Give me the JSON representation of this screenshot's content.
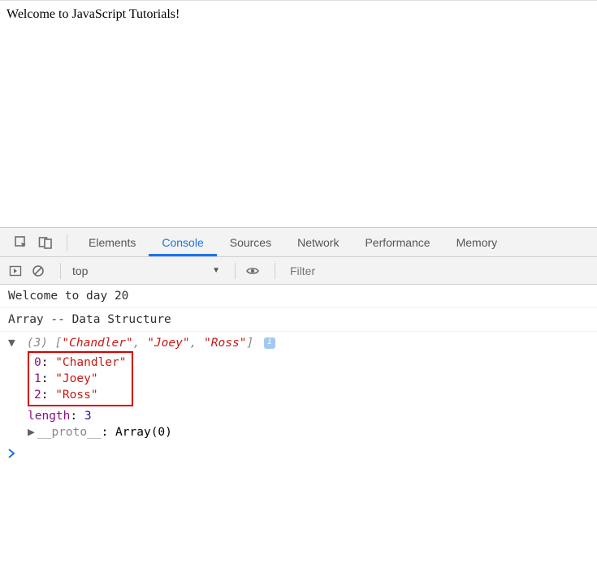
{
  "page": {
    "heading": "Welcome to JavaScript Tutorials!"
  },
  "devtools": {
    "tabs": [
      "Elements",
      "Console",
      "Sources",
      "Network",
      "Performance",
      "Memory"
    ],
    "active_tab": "Console",
    "context": "top",
    "filter_placeholder": "Filter",
    "console": {
      "lines": [
        "Welcome to day 20",
        "Array -- Data Structure"
      ],
      "array_summary": {
        "length_label": "(3)",
        "preview": "[\"Chandler\", \"Joey\", \"Ross\"]"
      },
      "array_items": [
        {
          "index": "0",
          "value": "\"Chandler\""
        },
        {
          "index": "1",
          "value": "\"Joey\""
        },
        {
          "index": "2",
          "value": "\"Ross\""
        }
      ],
      "length_key": "length",
      "length_val": "3",
      "proto_key": "__proto__",
      "proto_val": "Array(0)"
    },
    "prompt": ">"
  }
}
